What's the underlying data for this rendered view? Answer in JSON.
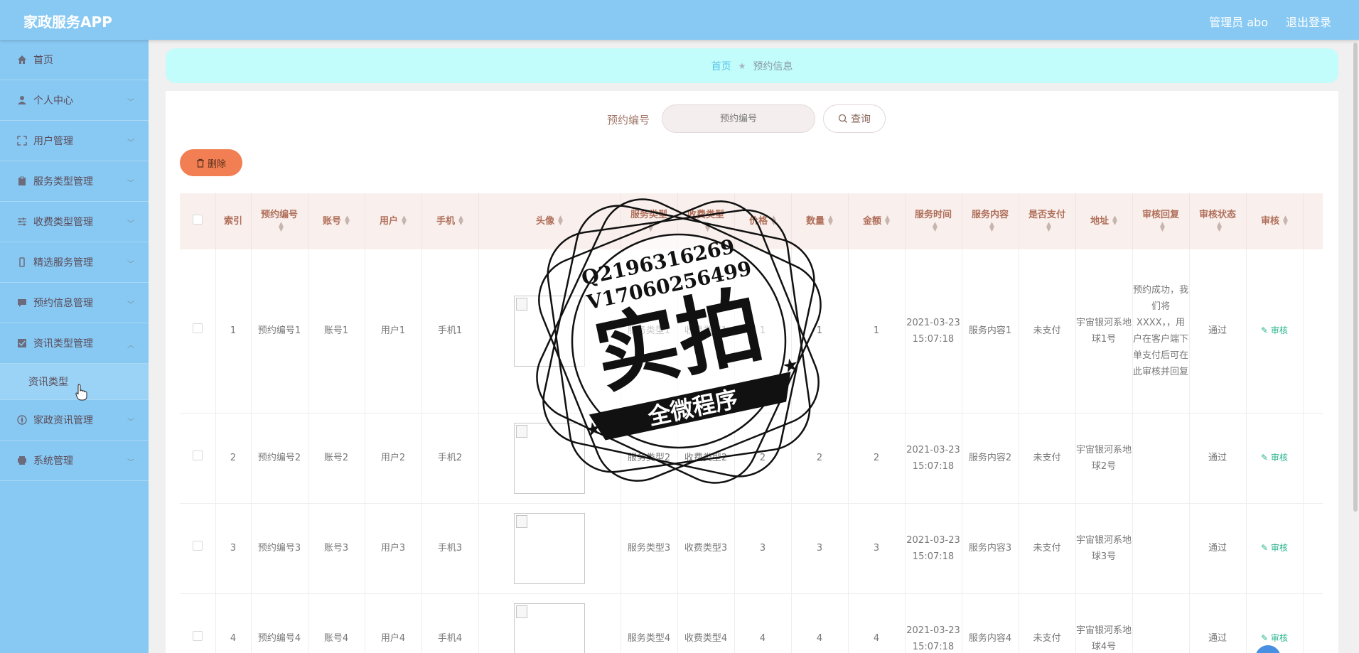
{
  "app": {
    "title": "家政服务APP"
  },
  "header": {
    "admin_label": "管理员 abo",
    "logout": "退出登录"
  },
  "sidebar": {
    "items": [
      {
        "label": "首页",
        "icon": "home-icon"
      },
      {
        "label": "个人中心",
        "icon": "user-icon"
      },
      {
        "label": "用户管理",
        "icon": "expand-icon"
      },
      {
        "label": "服务类型管理",
        "icon": "clipboard-icon"
      },
      {
        "label": "收费类型管理",
        "icon": "sliders-icon"
      },
      {
        "label": "精选服务管理",
        "icon": "phone-icon"
      },
      {
        "label": "预约信息管理",
        "icon": "chat-icon"
      },
      {
        "label": "资讯类型管理",
        "icon": "check-box-icon"
      },
      {
        "label": "家政资讯管理",
        "icon": "compass-icon"
      },
      {
        "label": "系统管理",
        "icon": "printer-icon"
      }
    ],
    "submenu": {
      "label": "资讯类型"
    }
  },
  "breadcrumb": {
    "home": "首页",
    "separator": "★",
    "current": "预约信息"
  },
  "search": {
    "label": "预约编号",
    "placeholder": "预约编号",
    "button": "查询"
  },
  "actions": {
    "delete": "删除"
  },
  "table": {
    "headers": [
      "索引",
      "预约编号",
      "账号",
      "用户",
      "手机",
      "头像",
      "服务类型",
      "收费类型",
      "价格",
      "数量",
      "金额",
      "服务时间",
      "服务内容",
      "是否支付",
      "地址",
      "审核回复",
      "审核状态",
      "审核"
    ],
    "rows": [
      {
        "index": "1",
        "order_no": "预约编号1",
        "account": "账号1",
        "user": "用户1",
        "phone": "手机1",
        "service_type": "服务类型1",
        "fee_type": "收费类型1",
        "price": "1",
        "quantity": "1",
        "amount": "1",
        "service_time": "2021-03-23 15:07:18",
        "content": "服务内容1",
        "paid": "未支付",
        "address": "宇宙银河系地球1号",
        "reply": "预约成功，我们将XXXX，，用户在客户端下单支付后可在此审核并回复",
        "status": "通过",
        "audit": "审核"
      },
      {
        "index": "2",
        "order_no": "预约编号2",
        "account": "账号2",
        "user": "用户2",
        "phone": "手机2",
        "service_type": "服务类型2",
        "fee_type": "收费类型2",
        "price": "2",
        "quantity": "2",
        "amount": "2",
        "service_time": "2021-03-23 15:07:18",
        "content": "服务内容2",
        "paid": "未支付",
        "address": "宇宙银河系地球2号",
        "reply": "",
        "status": "通过",
        "audit": "审核"
      },
      {
        "index": "3",
        "order_no": "预约编号3",
        "account": "账号3",
        "user": "用户3",
        "phone": "手机3",
        "service_type": "服务类型3",
        "fee_type": "收费类型3",
        "price": "3",
        "quantity": "3",
        "amount": "3",
        "service_time": "2021-03-23 15:07:18",
        "content": "服务内容3",
        "paid": "未支付",
        "address": "宇宙银河系地球3号",
        "reply": "",
        "status": "通过",
        "audit": "审核"
      },
      {
        "index": "4",
        "order_no": "预约编号4",
        "account": "账号4",
        "user": "用户4",
        "phone": "手机4",
        "service_type": "服务类型4",
        "fee_type": "收费类型4",
        "price": "4",
        "quantity": "4",
        "amount": "4",
        "service_time": "2021-03-23 15:07:18",
        "content": "服务内容4",
        "paid": "未支付",
        "address": "宇宙银河系地球4号",
        "reply": "",
        "status": "通过",
        "audit": "审核"
      }
    ]
  },
  "watermark": {
    "line1": "Q2196316269",
    "line2": "V17060256499",
    "main": "实拍",
    "banner": "全微程序"
  },
  "colors": {
    "header_bg": "#88c9f3",
    "sidebar_bg": "#88c9f3",
    "breadcrumb_bg": "#c2fcfb",
    "delete_btn": "#f17f53",
    "audit_text": "#29b48f",
    "table_header_bg": "#f9f0ed"
  }
}
